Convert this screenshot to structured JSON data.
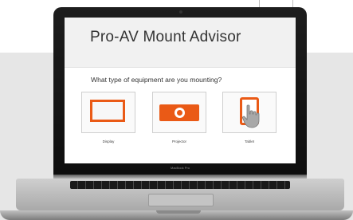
{
  "app": {
    "title": "Pro-AV Mount Advisor",
    "question": "What type of equipment are you mounting?"
  },
  "options": [
    {
      "label": "Display",
      "icon": "display-icon"
    },
    {
      "label": "Projector",
      "icon": "projector-icon"
    },
    {
      "label": "Tablet",
      "icon": "tablet-icon"
    }
  ],
  "laptop": {
    "brand": "MacBook Pro"
  },
  "colors": {
    "accent": "#ea5a16",
    "header_bg": "#f1f1f1",
    "page_band": "#e6e6e6"
  }
}
